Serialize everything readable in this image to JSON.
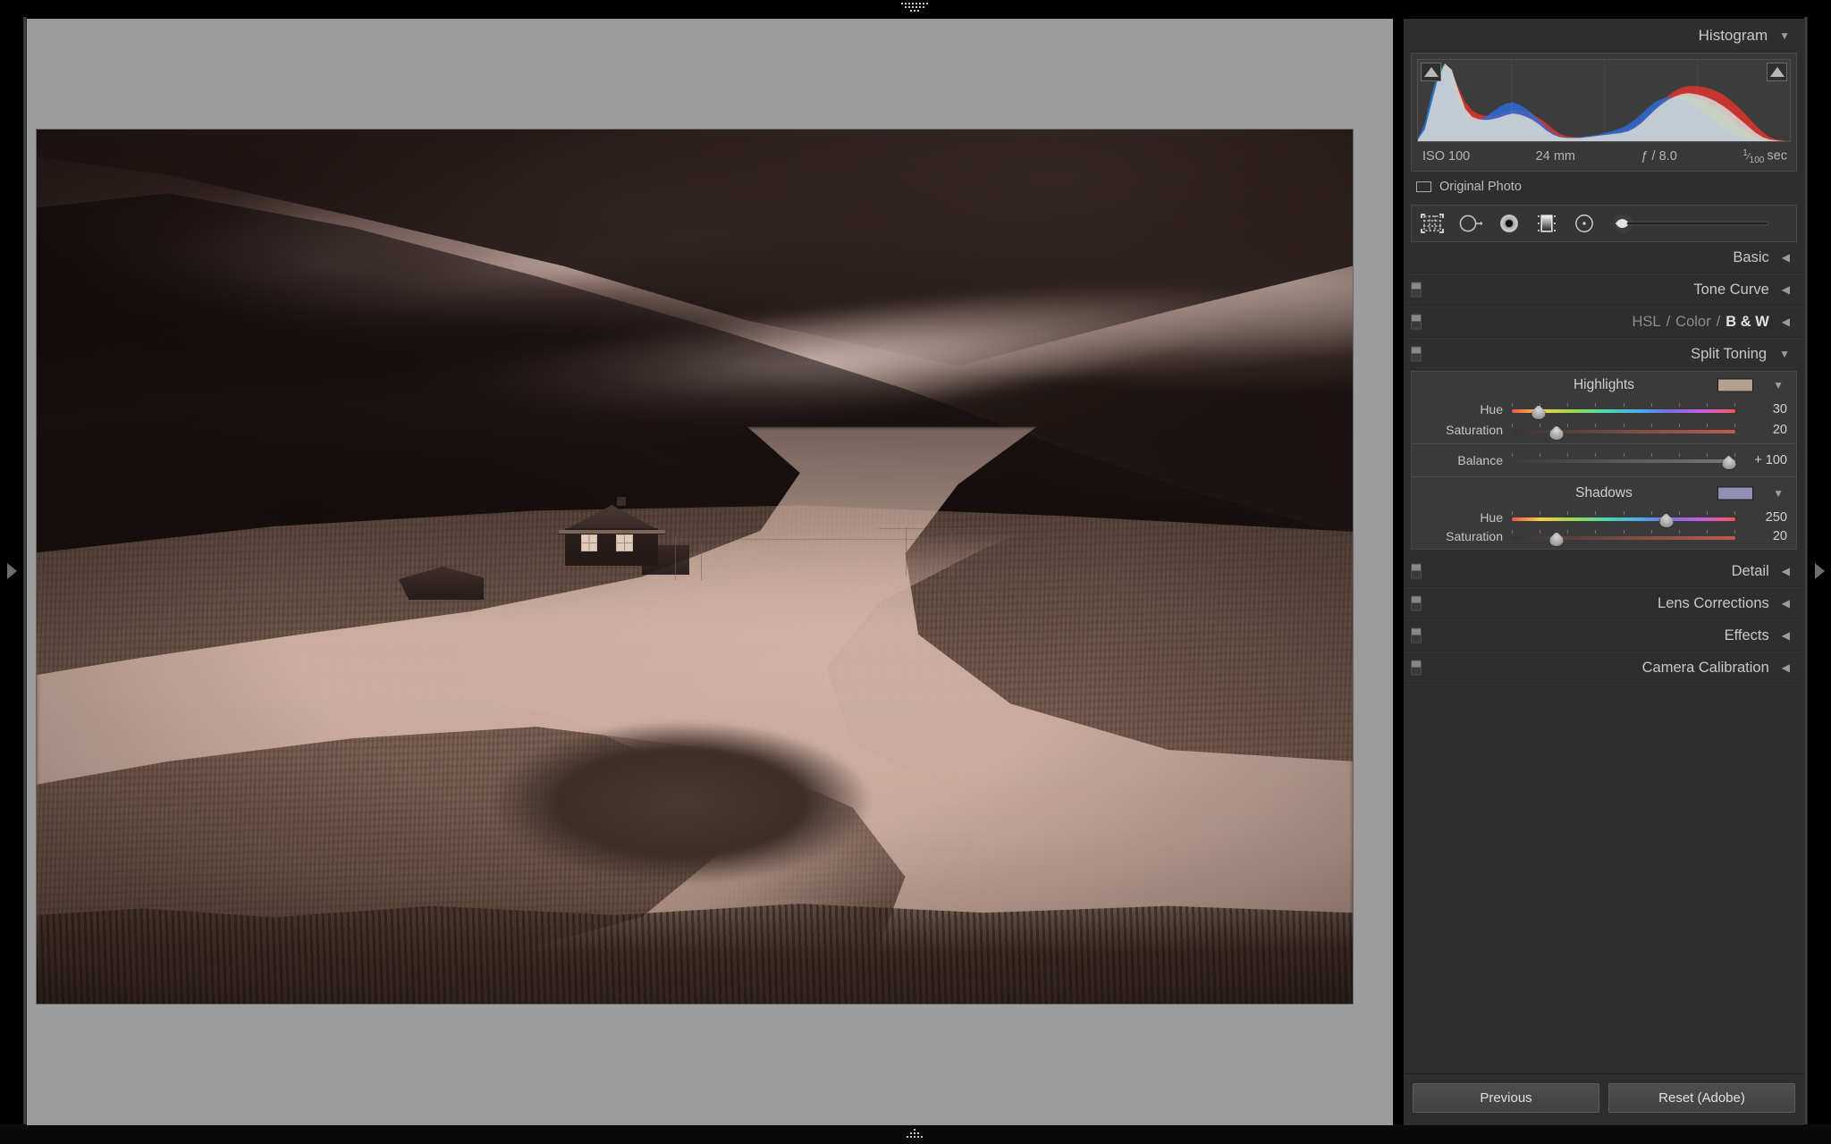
{
  "app": {
    "module": "Develop"
  },
  "histogram": {
    "title": "Histogram",
    "caret_icon": "chevron-down-icon",
    "clip_shadow_icon": "shadow-clipping-triangle-icon",
    "clip_highlight_icon": "highlight-clipping-triangle-icon",
    "meta": {
      "iso": "ISO 100",
      "focal_length": "24 mm",
      "aperture": "ƒ / 8.0",
      "shutter_numerator": "1",
      "shutter_denominator": "100",
      "shutter_unit": "sec"
    },
    "original_photo_label": "Original Photo",
    "original_photo_checked": false
  },
  "chart_data": {
    "type": "area",
    "title": "Histogram",
    "xlabel": "",
    "ylabel": "",
    "xlim": [
      0,
      255
    ],
    "ylim": [
      0,
      100
    ],
    "grid": false,
    "legend": "none",
    "series": [
      {
        "name": "Luminance",
        "color": "#d6d6d6",
        "values": [
          2,
          14,
          46,
          78,
          95,
          88,
          62,
          40,
          30,
          27,
          26,
          27,
          29,
          32,
          34,
          33,
          30,
          26,
          20,
          13,
          8,
          5,
          4,
          4,
          4,
          5,
          6,
          7,
          8,
          9,
          10,
          12,
          16,
          22,
          30,
          38,
          45,
          51,
          55,
          58,
          59,
          58,
          56,
          53,
          49,
          44,
          38,
          31,
          24,
          17,
          10,
          5,
          2,
          1,
          0,
          0
        ]
      },
      {
        "name": "Red",
        "color": "#e8352c",
        "values": [
          1,
          8,
          30,
          58,
          80,
          84,
          66,
          48,
          38,
          33,
          31,
          31,
          33,
          36,
          38,
          38,
          36,
          33,
          28,
          22,
          15,
          9,
          6,
          5,
          5,
          6,
          7,
          8,
          9,
          10,
          12,
          14,
          18,
          24,
          32,
          41,
          49,
          56,
          62,
          66,
          68,
          68,
          67,
          65,
          62,
          58,
          52,
          45,
          37,
          28,
          19,
          11,
          5,
          2,
          1,
          0
        ]
      },
      {
        "name": "Green",
        "color": "#36c23c",
        "values": [
          3,
          18,
          52,
          84,
          96,
          86,
          58,
          36,
          27,
          24,
          24,
          25,
          27,
          30,
          32,
          31,
          28,
          24,
          18,
          12,
          7,
          4,
          3,
          3,
          4,
          5,
          6,
          7,
          8,
          9,
          10,
          12,
          16,
          22,
          30,
          38,
          45,
          50,
          53,
          55,
          55,
          53,
          50,
          46,
          41,
          35,
          29,
          22,
          15,
          9,
          4,
          2,
          1,
          0,
          0,
          0
        ]
      },
      {
        "name": "Blue",
        "color": "#2a6ee0",
        "values": [
          4,
          22,
          58,
          86,
          92,
          78,
          50,
          32,
          26,
          26,
          30,
          36,
          42,
          46,
          48,
          45,
          40,
          33,
          25,
          17,
          10,
          6,
          4,
          4,
          5,
          6,
          7,
          9,
          11,
          13,
          16,
          20,
          26,
          33,
          41,
          48,
          52,
          54,
          54,
          52,
          48,
          43,
          37,
          31,
          24,
          18,
          12,
          7,
          4,
          2,
          1,
          0,
          0,
          0,
          0,
          0
        ]
      }
    ]
  },
  "toolstrip": {
    "tools": [
      {
        "name": "crop-overlay-icon",
        "label": "Crop Overlay"
      },
      {
        "name": "spot-removal-icon",
        "label": "Spot Removal"
      },
      {
        "name": "red-eye-correction-icon",
        "label": "Red Eye Correction"
      },
      {
        "name": "graduated-filter-icon",
        "label": "Graduated Filter"
      },
      {
        "name": "radial-filter-icon",
        "label": "Radial Filter"
      },
      {
        "name": "adjustment-brush-icon",
        "label": "Adjustment Brush"
      }
    ]
  },
  "panels": [
    {
      "id": "basic",
      "title": "Basic",
      "arrow": "◀",
      "switch": false,
      "expanded": false
    },
    {
      "id": "tone-curve",
      "title": "Tone Curve",
      "arrow": "◀",
      "switch": true,
      "expanded": false
    },
    {
      "id": "hsl-color-bw",
      "title": "HSL / Color / B & W",
      "arrow": "◀",
      "switch": true,
      "expanded": false,
      "parts": [
        {
          "text": "HSL",
          "active": false
        },
        {
          "text": "Color",
          "active": false
        },
        {
          "text": "B & W",
          "active": true
        }
      ],
      "separator": "/"
    },
    {
      "id": "split-toning",
      "title": "Split Toning",
      "arrow": "▼",
      "switch": true,
      "expanded": true
    },
    {
      "id": "detail",
      "title": "Detail",
      "arrow": "◀",
      "switch": true,
      "expanded": false
    },
    {
      "id": "lens-corrections",
      "title": "Lens Corrections",
      "arrow": "◀",
      "switch": true,
      "expanded": false
    },
    {
      "id": "effects",
      "title": "Effects",
      "arrow": "◀",
      "switch": true,
      "expanded": false
    },
    {
      "id": "camera-calibration",
      "title": "Camera Calibration",
      "arrow": "◀",
      "switch": true,
      "expanded": false
    }
  ],
  "split_toning": {
    "highlights": {
      "group_label": "Highlights",
      "swatch_color": "#b2a091",
      "dropdown_icon": "chevron-down-icon",
      "hue": {
        "label": "Hue",
        "value": "30",
        "pct": 12
      },
      "saturation": {
        "label": "Saturation",
        "value": "20",
        "pct": 20
      }
    },
    "balance": {
      "label": "Balance",
      "value": "+ 100",
      "pct": 97
    },
    "shadows": {
      "group_label": "Shadows",
      "swatch_color": "#9290b4",
      "dropdown_icon": "chevron-down-icon",
      "hue": {
        "label": "Hue",
        "value": "250",
        "pct": 69
      },
      "saturation": {
        "label": "Saturation",
        "value": "20",
        "pct": 20
      }
    }
  },
  "footer": {
    "previous_label": "Previous",
    "reset_label": "Reset (Adobe)"
  },
  "edges": {
    "left_arrow_icon": "panel-expand-right-icon",
    "right_arrow_icon": "panel-expand-right-icon",
    "top_handle_icon": "dot-grid-triangle-down-icon",
    "bottom_handle_icon": "dot-grid-triangle-up-icon"
  },
  "colors": {
    "panel_bg": "#2e2e2e",
    "canvas_bg": "#9c9c9c",
    "accent_text": "#c9c9c9",
    "highlight_swatch": "#b2a091",
    "shadow_swatch": "#9290b4"
  }
}
